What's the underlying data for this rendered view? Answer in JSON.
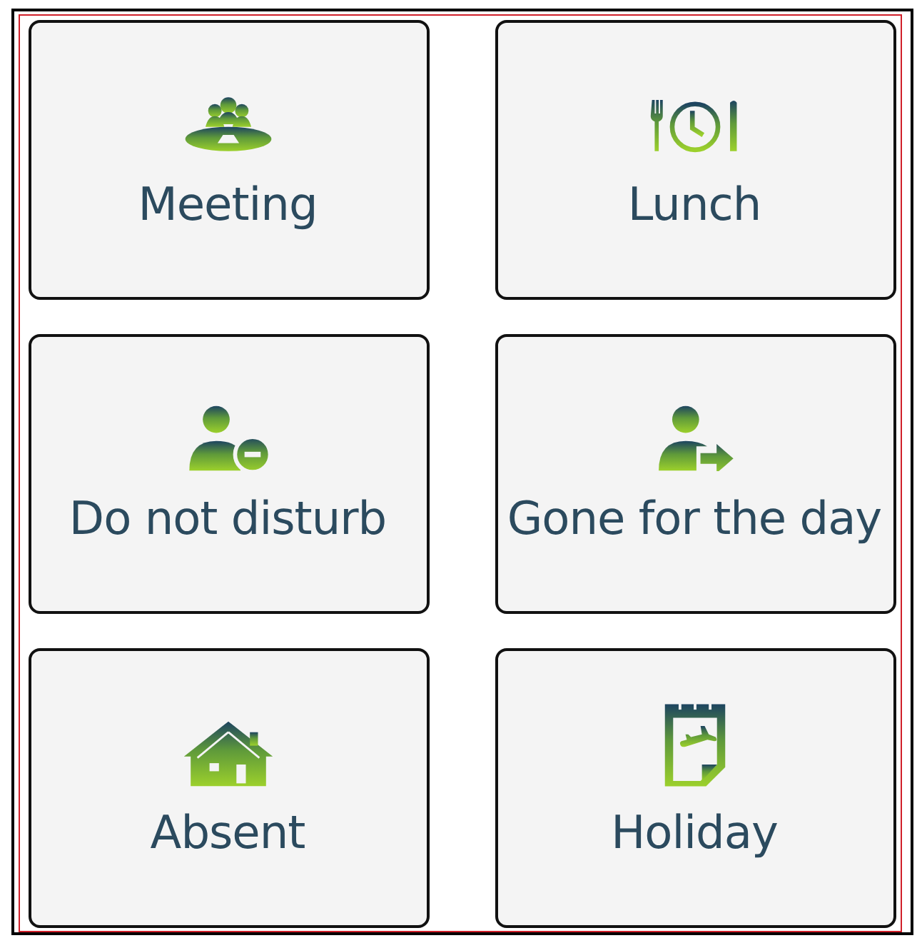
{
  "status_buttons": [
    {
      "label": "Meeting",
      "kind": "meeting"
    },
    {
      "label": "Lunch",
      "kind": "lunch"
    },
    {
      "label": "Do not disturb",
      "kind": "dnd"
    },
    {
      "label": "Gone for the day",
      "kind": "gone"
    },
    {
      "label": "Absent",
      "kind": "absent"
    },
    {
      "label": "Holiday",
      "kind": "holiday"
    }
  ]
}
